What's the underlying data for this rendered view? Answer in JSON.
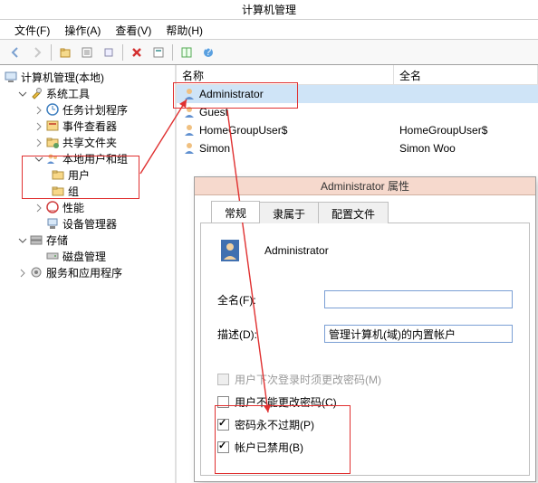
{
  "window": {
    "title": "计算机管理"
  },
  "menu": {
    "file": "文件(F)",
    "action": "操作(A)",
    "view": "查看(V)",
    "help": "帮助(H)"
  },
  "tree": {
    "root": "计算机管理(本地)",
    "systools": "系统工具",
    "taskscheduler": "任务计划程序",
    "eventviewer": "事件查看器",
    "sharedfolders": "共享文件夹",
    "localusersgroups": "本地用户和组",
    "users": "用户",
    "groups": "组",
    "performance": "性能",
    "devicemgr": "设备管理器",
    "storage": "存储",
    "diskmgmt": "磁盘管理",
    "services": "服务和应用程序"
  },
  "list": {
    "header_name": "名称",
    "header_fullname": "全名",
    "rows": [
      {
        "name": "Administrator",
        "fullname": ""
      },
      {
        "name": "Guest",
        "fullname": ""
      },
      {
        "name": "HomeGroupUser$",
        "fullname": "HomeGroupUser$"
      },
      {
        "name": "Simon",
        "fullname": "Simon Woo"
      }
    ]
  },
  "dialog": {
    "title": "Administrator 属性",
    "tabs": {
      "general": "常规",
      "memberof": "隶属于",
      "profile": "配置文件"
    },
    "name": "Administrator",
    "fullname_label": "全名(F):",
    "fullname_value": "",
    "desc_label": "描述(D):",
    "desc_value": "管理计算机(域)的内置帐户",
    "chk_must_change": "用户下次登录时须更改密码(M)",
    "chk_cannot_change": "用户不能更改密码(C)",
    "chk_never_expire": "密码永不过期(P)",
    "chk_disabled": "帐户已禁用(B)"
  }
}
